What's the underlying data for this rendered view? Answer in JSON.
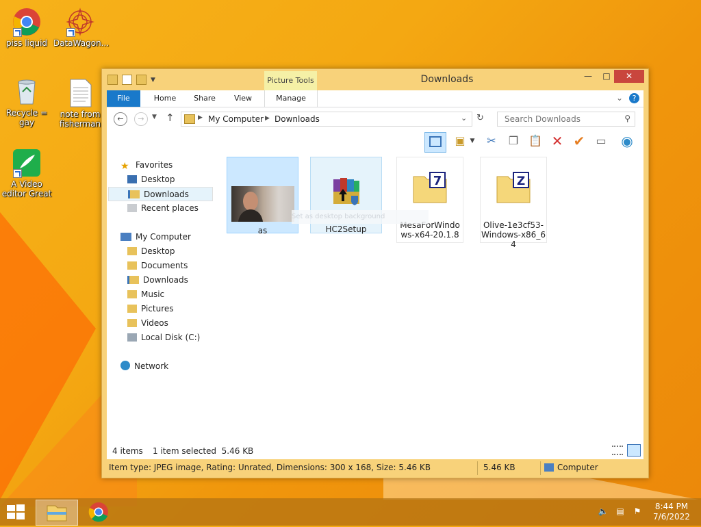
{
  "desktop": {
    "icons": [
      {
        "label": "piss liquid"
      },
      {
        "label": "DataWagon..."
      },
      {
        "label": "Recycle = gay"
      },
      {
        "label": "note from fisherman"
      },
      {
        "label": "A Video editor Great"
      }
    ]
  },
  "window": {
    "title": "Downloads",
    "contextual_group": "Picture Tools",
    "tabs": [
      "File",
      "Home",
      "Share",
      "View",
      "Manage"
    ],
    "address": {
      "segments": [
        "My Computer",
        "Downloads"
      ]
    },
    "search": {
      "placeholder": "Search Downloads"
    },
    "nav": {
      "favorites": {
        "label": "Favorites",
        "items": [
          "Desktop",
          "Downloads",
          "Recent places"
        ]
      },
      "computer": {
        "label": "My Computer",
        "items": [
          "Desktop",
          "Documents",
          "Downloads",
          "Music",
          "Pictures",
          "Videos",
          "Local Disk (C:)"
        ]
      },
      "network": {
        "label": "Network"
      }
    },
    "files": [
      {
        "name": "as",
        "selected": true
      },
      {
        "name": "HC2Setup",
        "selected": false
      },
      {
        "name": "MesaForWindows-x64-20.1.8",
        "selected": false
      },
      {
        "name": "Olive-1e3cf53-Windows-x86_64",
        "selected": false
      }
    ],
    "tooltip": "Set as desktop background",
    "status": {
      "count": "4 items",
      "selection": "1 item selected  5.46 KB"
    },
    "details": {
      "info": "Item type: JPEG image, Rating: Unrated, Dimensions: 300 x 168, Size: 5.46 KB",
      "size": "5.46 KB",
      "location": "Computer"
    }
  },
  "taskbar": {
    "time": "8:44 PM",
    "date": "7/6/2022"
  },
  "colors": {
    "accent": "#1979ca",
    "selection": "#cce8ff",
    "frame": "#f8d27a"
  }
}
